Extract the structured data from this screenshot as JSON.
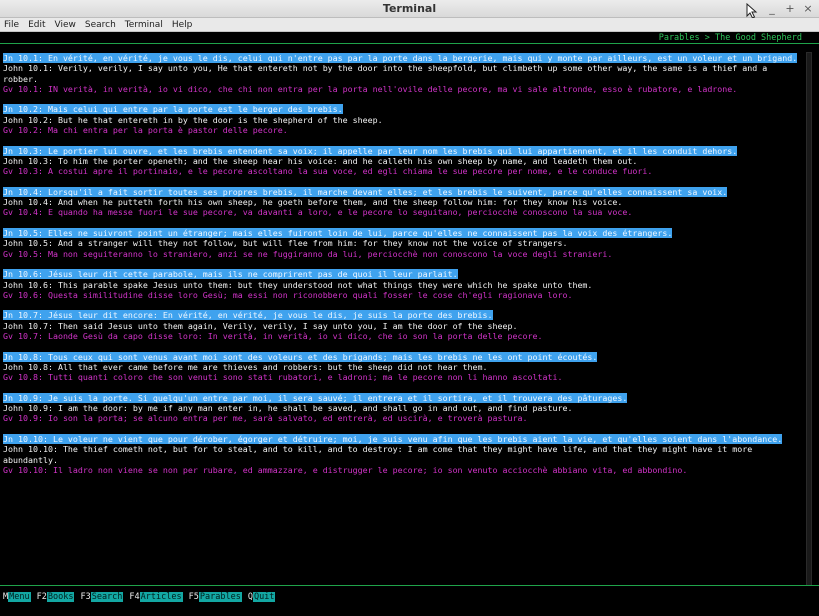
{
  "window": {
    "title": "Terminal",
    "controls": [
      "_",
      "+",
      "×"
    ]
  },
  "menu": [
    "File",
    "Edit",
    "View",
    "Search",
    "Terminal",
    "Help"
  ],
  "breadcrumb": "Parables > The Good Shepherd",
  "verses": [
    {
      "fr": "Jn 10.1: En vérité, en vérité, je vous le dis, celui qui n'entre pas par la porte dans la bergerie, mais qui y monte par ailleurs, est un voleur et un brigand.",
      "en": "John 10.1: Verily, verily, I say unto you, He that entereth not by the door into the sheepfold, but climbeth up some other way, the same is a thief and a robber.",
      "it": "Gv 10.1: IN verità, in verità, io vi dico, che chi non entra per la porta nell'ovile delle pecore, ma vi sale altronde, esso è rubatore, e ladrone."
    },
    {
      "fr": "Jn 10.2: Mais celui qui entre par la porte est le berger des brebis.",
      "en": "John 10.2: But he that entereth in by the door is the shepherd of the sheep.",
      "it": "Gv 10.2: Ma chi entra per la porta è pastor delle pecore."
    },
    {
      "fr": "Jn 10.3: Le portier lui ouvre, et les brebis entendent sa voix; il appelle par leur nom les brebis qui lui appartiennent, et il les conduit dehors.",
      "en": "John 10.3: To him the porter openeth; and the sheep hear his voice: and he calleth his own sheep by name, and leadeth them out.",
      "it": "Gv 10.3: A costui apre il portinaio, e le pecore ascoltano la sua voce, ed egli chiama le sue pecore per nome, e le conduce fuori."
    },
    {
      "fr": "Jn 10.4: Lorsqu'il a fait sortir toutes ses propres brebis, il marche devant elles; et les brebis le suivent, parce qu'elles connaissent sa voix.",
      "en": "John 10.4: And when he putteth forth his own sheep, he goeth before them, and the sheep follow him: for they know his voice.",
      "it": "Gv 10.4: E quando ha messe fuori le sue pecore, va davanti a loro, e le pecore lo seguitano, perciocchè conoscono la sua voce."
    },
    {
      "fr": "Jn 10.5: Elles ne suivront point un étranger; mais elles fuiront loin de lui, parce qu'elles ne connaissent pas la voix des étrangers.",
      "en": "John 10.5: And a stranger will they not follow, but will flee from him: for they know not the voice of strangers.",
      "it": "Gv 10.5: Ma non seguiteranno lo straniero, anzi se ne fuggiranno da lui, perciocchè non conoscono la voce degli stranieri."
    },
    {
      "fr": "Jn 10.6: Jésus leur dit cette parabole, mais ils ne comprirent pas de quoi il leur parlait.",
      "en": "John 10.6: This parable spake Jesus unto them: but they understood not what things they were which he spake unto them.",
      "it": "Gv 10.6: Questa similitudine disse loro Gesù; ma essi non riconobbero quali fosser le cose ch'egli ragionava loro."
    },
    {
      "fr": "Jn 10.7: Jésus leur dit encore: En vérité, en vérité, je vous le dis, je suis la porte des brebis.",
      "en": "John 10.7: Then said Jesus unto them again, Verily, verily, I say unto you, I am the door of the sheep.",
      "it": "Gv 10.7: Laonde Gesù da capo disse loro: In verità, in verità, io vi dico, che io son la porta delle pecore."
    },
    {
      "fr": "Jn 10.8: Tous ceux qui sont venus avant moi sont des voleurs et des brigands; mais les brebis ne les ont point écoutés.",
      "en": "John 10.8: All that ever came before me are thieves and robbers: but the sheep did not hear them.",
      "it": "Gv 10.8: Tutti quanti coloro che son venuti sono stati rubatori, e ladroni; ma le pecore non li hanno ascoltati."
    },
    {
      "fr": "Jn 10.9: Je suis la porte. Si quelqu'un entre par moi, il sera sauvé; il entrera et il sortira, et il trouvera des pâturages.",
      "en": "John 10.9: I am the door: by me if any man enter in, he shall be saved, and shall go in and out, and find pasture.",
      "it": "Gv 10.9: Io son la porta; se alcuno entra per me, sarà salvato, ed entrerà, ed uscirà, e troverà pastura."
    },
    {
      "fr": "Jn 10.10: Le voleur ne vient que pour dérober, égorger et détruire; moi, je suis venu afin que les brebis aient la vie, et qu'elles soient dans l'abondance.",
      "en": "John 10.10: The thief cometh not, but for to steal, and to kill, and to destroy: I am come that they might have life, and that they might have it more abundantly.",
      "it": "Gv 10.10: Il ladro non viene se non per rubare, ed ammazzare, e distrugger le pecore; io son venuto acciocchè abbiano vita, ed abbondino."
    }
  ],
  "footer": [
    {
      "key": "M",
      "label": "Menu"
    },
    {
      "key": "F2",
      "label": "Books"
    },
    {
      "key": "F3",
      "label": "Search"
    },
    {
      "key": "F4",
      "label": "Articles"
    },
    {
      "key": "F5",
      "label": "Parables"
    },
    {
      "key": "Q",
      "label": "Quit"
    }
  ],
  "colors": {
    "french_highlight": "#3fa2ee",
    "english_text": "#f2f2f2",
    "italian_text": "#d233c9",
    "accent_green": "#2ec45a",
    "footer_key_bg": "#13a7a3"
  }
}
